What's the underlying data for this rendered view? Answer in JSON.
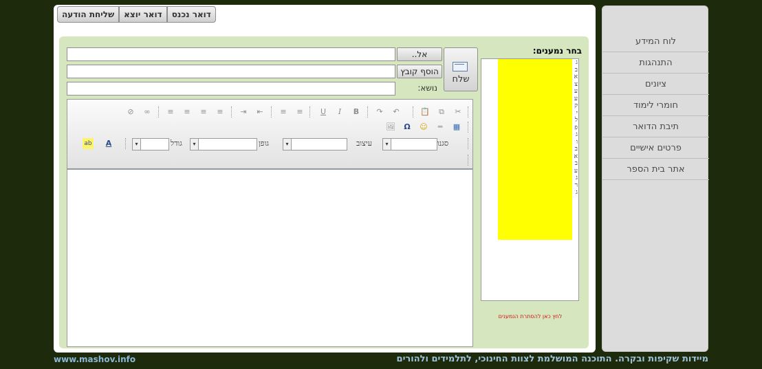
{
  "tabs": [
    "שליחת הודעה",
    "דואר יוצא",
    "דואר נכנס"
  ],
  "nav": [
    "לוח המידע",
    "התנהגות",
    "ציונים",
    "חומרי לימוד",
    "תיבת הדואר",
    "פרטים אישיים",
    "אתר בית הספר"
  ],
  "recipients": {
    "title": "בחר נמענים:",
    "letters": [
      "ג",
      "ב",
      "א",
      "צ",
      "ע",
      "ע",
      "ק",
      "י",
      "ל",
      "פ",
      "ג",
      "ו",
      "ב",
      "א",
      "ב",
      "ע",
      "ג",
      "ר",
      "ג"
    ],
    "hide_link": "לחץ כאן להסתרת הנמענים"
  },
  "compose": {
    "send_label": "שלח",
    "to_button": "אל..",
    "attach_button": "הוסף קובץ",
    "subject_label": "נושא:"
  },
  "toolbar": {
    "style_label": "סגנון",
    "format_label": "עיצוב",
    "font_label": "גופן",
    "size_label": "גודל",
    "glyphs": {
      "cut": "✂",
      "copy": "⧉",
      "paste": "📋",
      "undo": "↶",
      "redo": "↷",
      "bold": "B",
      "italic": "I",
      "underline": "U",
      "ol": "≡",
      "ul": "≡",
      "outdent": "⇤",
      "indent": "⇥",
      "align_left": "≡",
      "align_center": "≡",
      "align_right": "≡",
      "justify": "≡",
      "link": "∞",
      "unlink": "⊘",
      "table": "▦",
      "hr": "═",
      "smiley": "☺",
      "omega": "Ω",
      "image": "🖼",
      "text_color": "A",
      "bg_color": "ab"
    }
  },
  "footer": {
    "site": "www.mashov.info",
    "tagline": "מיידות שקיפות ובקרה. התוכנה המושלמת לצוות החינוכי, לתלמידים ולהורים"
  },
  "colors": {
    "background": "#1d2a0c",
    "panel": "#d6e7bf",
    "highlight": "#ffff00",
    "link": "#d01010"
  }
}
